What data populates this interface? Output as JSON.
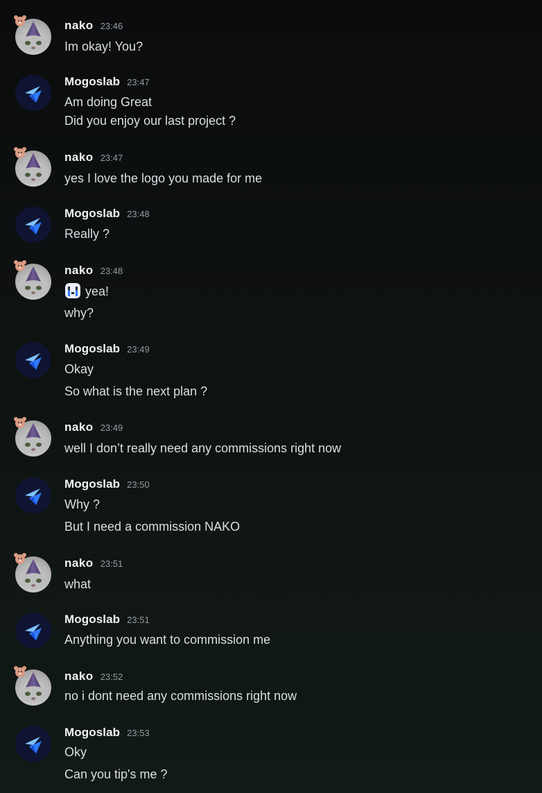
{
  "chat": {
    "messages": [
      {
        "author": "nako",
        "time": "23:46",
        "lines": [
          "Im okay! You?"
        ]
      },
      {
        "author": "Mogoslab",
        "time": "23:47",
        "lines": [
          "Am doing Great",
          "Did you enjoy our last project ?"
        ]
      },
      {
        "author": "nako",
        "time": "23:47",
        "lines": [
          "yes I love the logo you made for me"
        ]
      },
      {
        "author": "Mogoslab",
        "time": "23:48",
        "lines": [
          "Really ?"
        ]
      },
      {
        "author": "nako",
        "time": "23:48",
        "lines": [
          "yea!",
          "why?"
        ]
      },
      {
        "author": "Mogoslab",
        "time": "23:49",
        "lines": [
          "Okay",
          "So what is the next plan ?"
        ]
      },
      {
        "author": "nako",
        "time": "23:49",
        "lines": [
          "well I don’t really need any commissions right now"
        ]
      },
      {
        "author": "Mogoslab",
        "time": "23:50",
        "lines": [
          "Why ?",
          "But I need a commission NAKO"
        ]
      },
      {
        "author": "nako",
        "time": "23:51",
        "lines": [
          "what"
        ]
      },
      {
        "author": "Mogoslab",
        "time": "23:51",
        "lines": [
          "Anything you want to commission me"
        ]
      },
      {
        "author": "nako",
        "time": "23:52",
        "lines": [
          "no i dont need any commissions right now"
        ]
      },
      {
        "author": "Mogoslab",
        "time": "23:53",
        "lines": [
          "Oky",
          "Can you tip's me ?"
        ]
      }
    ]
  },
  "icons": {
    "nako_avatar": "cat-wizard-hat-avatar",
    "mogoslab_avatar": "blue-bird-logo-avatar",
    "emoji": "crying-face-emoji",
    "avatar_decoration": "bear-decoration"
  },
  "colors": {
    "background": "#0b0c0d",
    "username": "#f2f3f5",
    "timestamp": "#949ba4",
    "text": "#dbdee1",
    "brand_blue": "#2f7bff",
    "avatar_dark": "#0e1431"
  }
}
